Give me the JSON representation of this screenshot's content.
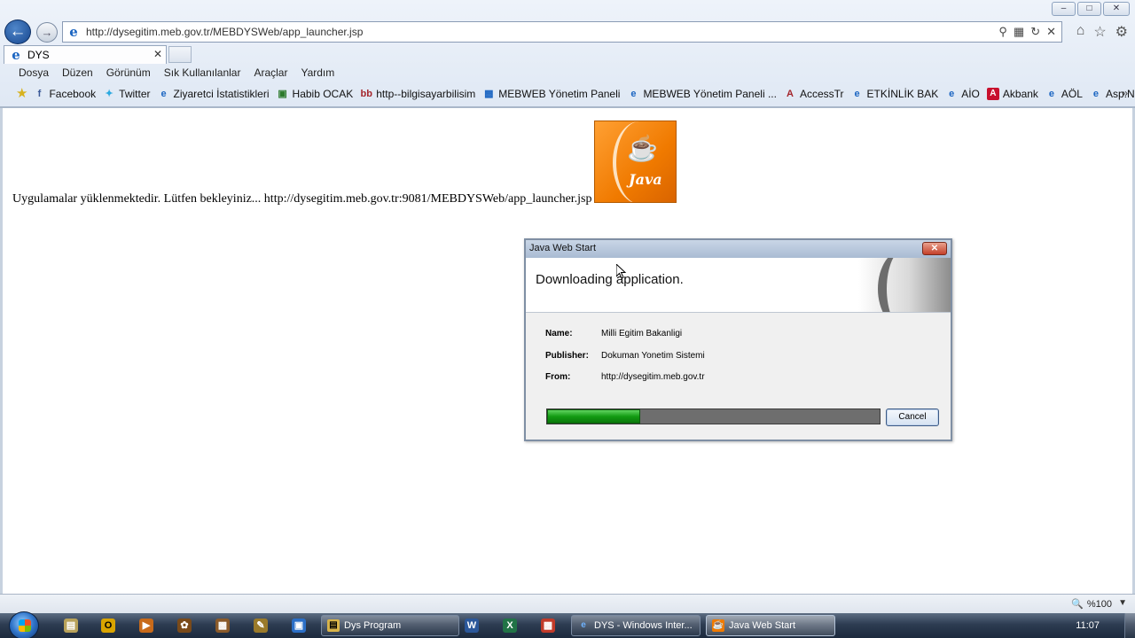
{
  "browser": {
    "address": "http://dysegitim.meb.gov.tr/MEBDYSWeb/app_launcher.jsp",
    "tab_label": "DYS",
    "menu": [
      "Dosya",
      "Düzen",
      "Görünüm",
      "Sık Kullanılanlar",
      "Araçlar",
      "Yardım"
    ],
    "favorites": [
      {
        "label": "Facebook",
        "icon": "facebook-icon"
      },
      {
        "label": "Twitter",
        "icon": "twitter-icon"
      },
      {
        "label": "Ziyaretci İstatistikleri",
        "icon": "ie-page-icon"
      },
      {
        "label": "Habib OCAK",
        "icon": "user-page-icon"
      },
      {
        "label": "http--bilgisayarbilisim",
        "icon": "bb-icon"
      },
      {
        "label": "MEBWEB  Yönetim Paneli",
        "icon": "meb-icon"
      },
      {
        "label": "MEBWEB  Yönetim Paneli ...",
        "icon": "ie-page-icon"
      },
      {
        "label": "AccessTr",
        "icon": "access-icon"
      },
      {
        "label": "ETKİNLİK BAK",
        "icon": "ie-page-icon"
      },
      {
        "label": "AİO",
        "icon": "ie-page-icon"
      },
      {
        "label": "Akbank",
        "icon": "akbank-icon"
      },
      {
        "label": "AÖL",
        "icon": "ie-page-icon"
      },
      {
        "label": "Asp.Net",
        "icon": "ie-page-icon"
      }
    ],
    "zoom": "%100"
  },
  "page": {
    "loading_message": "Uygulamalar yüklenmektedir. Lütfen bekleyiniz... http://dysegitim.meb.gov.tr:9081/MEBDYSWeb/app_launcher.jsp",
    "java_logo_text": "Java"
  },
  "dialog": {
    "title": "Java Web Start",
    "heading": "Downloading application.",
    "name_label": "Name:",
    "name_value": "Milli Egitim Bakanligi",
    "publisher_label": "Publisher:",
    "publisher_value": "Dokuman Yonetim Sistemi",
    "from_label": "From:",
    "from_value": "http://dysegitim.meb.gov.tr",
    "progress_fraction": 0.28,
    "cancel_label": "Cancel"
  },
  "taskbar": {
    "items": [
      {
        "label": "Dys Program",
        "icon": "folder-icon"
      },
      {
        "label": "DYS - Windows Inter...",
        "icon": "ie-icon"
      },
      {
        "label": "Java Web Start",
        "icon": "java-icon"
      }
    ],
    "clock": "11:07"
  },
  "colors": {
    "progress_fill": "#139b13",
    "java_orange": "#f07a00",
    "taskbar": "#2d3c52"
  }
}
